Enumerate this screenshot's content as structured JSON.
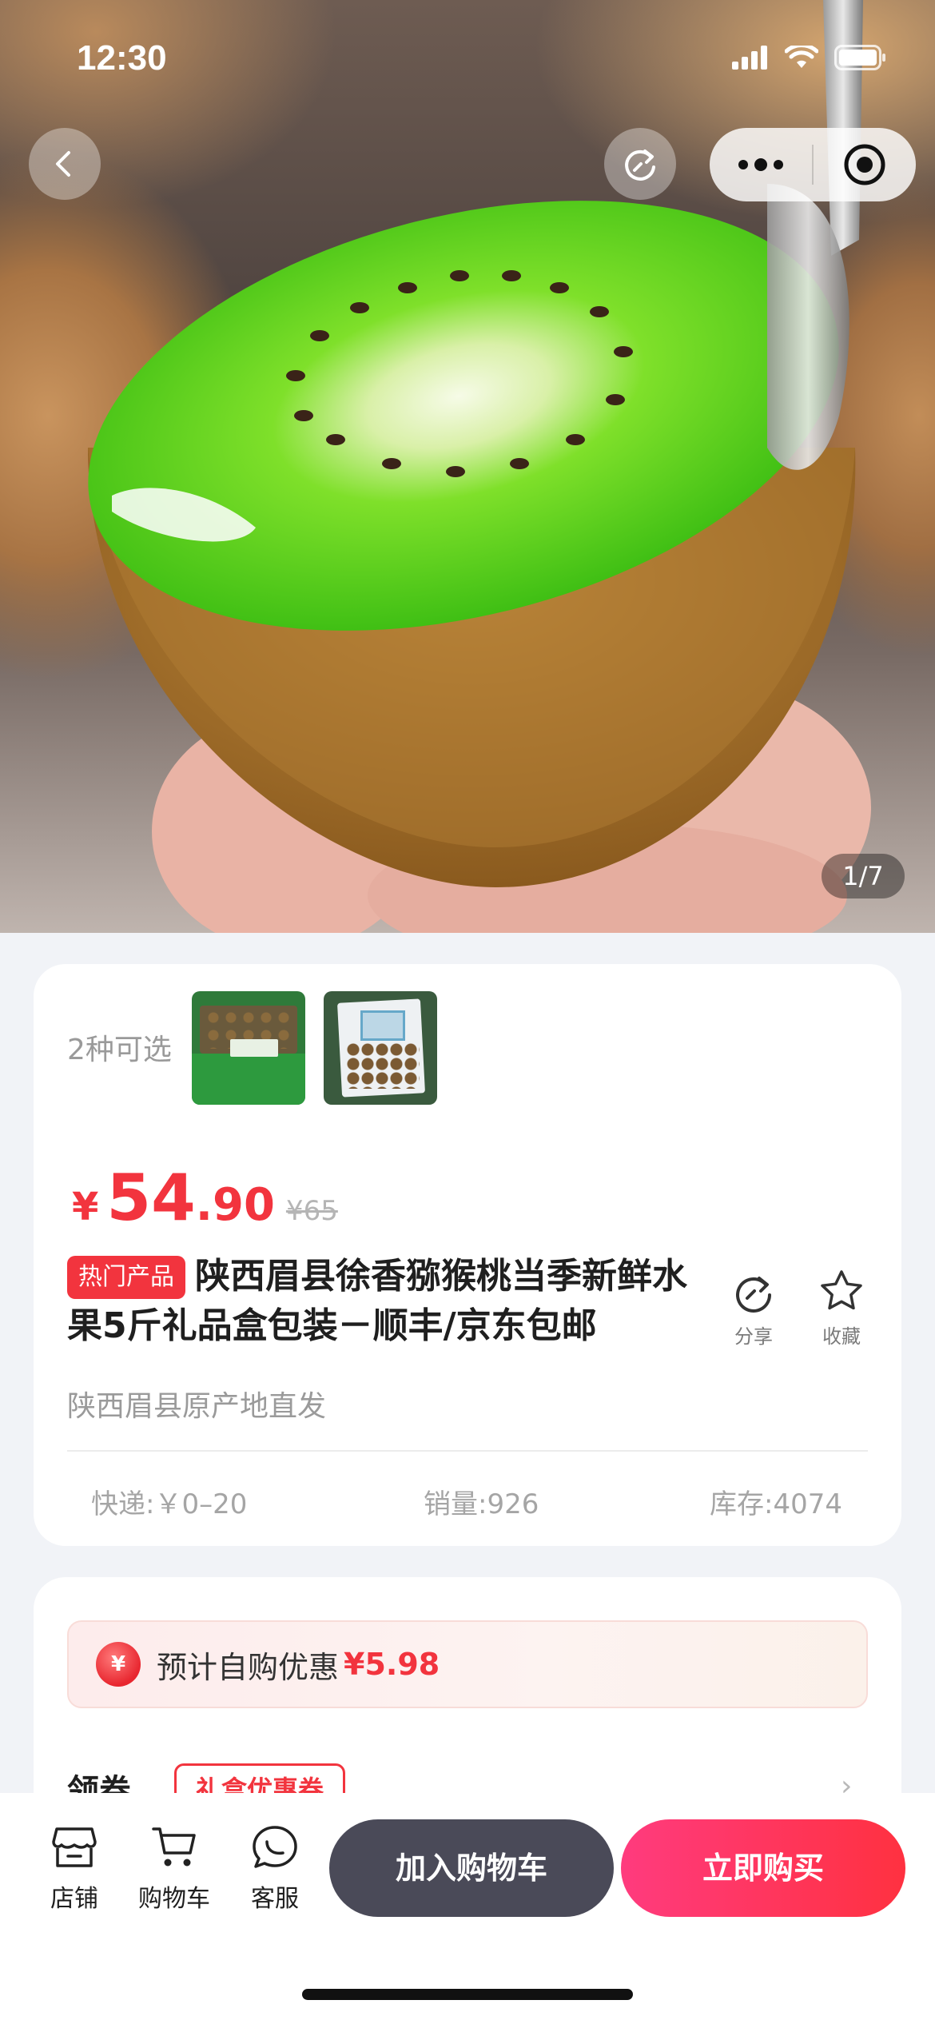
{
  "status": {
    "time": "12:30"
  },
  "gallery": {
    "counter": "1/7"
  },
  "variants": {
    "label": "2种可选"
  },
  "price": {
    "currency": "¥",
    "integer": "54",
    "decimal": ".90",
    "original": "¥65"
  },
  "product": {
    "tag": "热门产品",
    "title": "陕西眉县徐香猕猴桃当季新鲜水果5斤礼品盒包装－顺丰/京东包邮",
    "origin": "陕西眉县原产地直发"
  },
  "actions": {
    "share_label": "分享",
    "favorite_label": "收藏"
  },
  "stats": {
    "shipping": "快递:￥0–20",
    "sales": "销量:926",
    "stock": "库存:4074"
  },
  "promo": {
    "icon_text": "¥",
    "label": "预计自购优惠",
    "amount": "¥5.98"
  },
  "coupon": {
    "label": "领券",
    "tag": "礼盒优惠券"
  },
  "bottom_nav": {
    "store_label": "店铺",
    "cart_label": "购物车",
    "service_label": "客服",
    "add_cart_button": "加入购物车",
    "buy_now_button": "立即购买"
  },
  "colors": {
    "accent_red": "#F2343E",
    "cart_button": "#4A4A58",
    "buy_button_start": "#FF3B7E",
    "buy_button_end": "#FF3140"
  },
  "icons": [
    "back-icon",
    "refresh-icon",
    "more-icon",
    "target-icon",
    "share-icon",
    "star-icon",
    "store-icon",
    "cart-icon",
    "chat-icon"
  ]
}
